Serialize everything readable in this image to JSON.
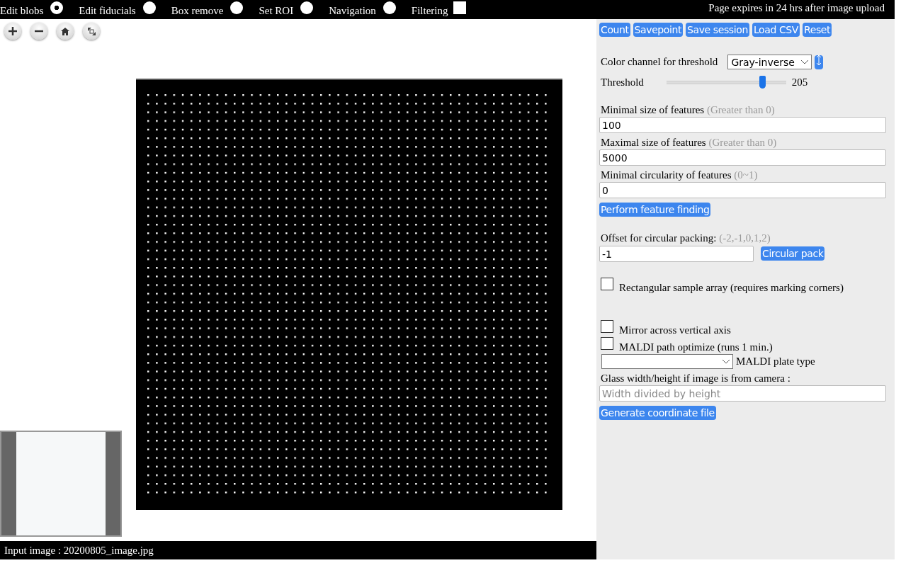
{
  "top_bar": {
    "modes": [
      {
        "label": "Edit blobs",
        "kind": "radio",
        "selected": true
      },
      {
        "label": "Edit fiducials",
        "kind": "radio",
        "selected": false
      },
      {
        "label": "Box remove",
        "kind": "radio",
        "selected": false
      },
      {
        "label": "Set ROI",
        "kind": "radio",
        "selected": false
      },
      {
        "label": "Navigation",
        "kind": "radio",
        "selected": false
      },
      {
        "label": "Filtering",
        "kind": "checkbox",
        "checked": false
      }
    ],
    "notice": "Page expires in 24 hrs after image upload"
  },
  "panel": {
    "buttons": [
      "Count",
      "Savepoint",
      "Save session",
      "Load CSV",
      "Reset"
    ],
    "color_channel": {
      "label": "Color channel for threshold",
      "value": "Gray-inverse"
    },
    "threshold": {
      "label": "Threshold",
      "level": 0.8,
      "reading": "205"
    },
    "fields": [
      {
        "label": "Minimal size of features",
        "hint": "(Greater than 0)",
        "value": "100"
      },
      {
        "label": "Maximal size of features",
        "hint": "(Greater than 0)",
        "value": "5000"
      },
      {
        "label": "Minimal circularity of features",
        "hint": "(0~1)",
        "value": "0"
      }
    ],
    "find_button": "Perform feature finding",
    "offset": {
      "label": "Offset for circular packing:",
      "hint": "(-2,-1,0,1,2)",
      "value": "-1",
      "button": "Circular pack"
    },
    "options": [
      {
        "label": "Rectangular sample array (requires marking corners)",
        "checked": false
      },
      {
        "label": "Mirror across vertical axis",
        "checked": false
      },
      {
        "label": "MALDI path optimize (runs 1 min.)",
        "checked": false
      }
    ],
    "plate_type": {
      "label": "MALDI plate type"
    },
    "glass": {
      "label": "Glass width/height if image is from camera :",
      "placeholder": "Width divided by height"
    },
    "generate_button": "Generate coordinate file"
  },
  "status_bar": {
    "text": "Input image : 20200805_image.jpg"
  }
}
